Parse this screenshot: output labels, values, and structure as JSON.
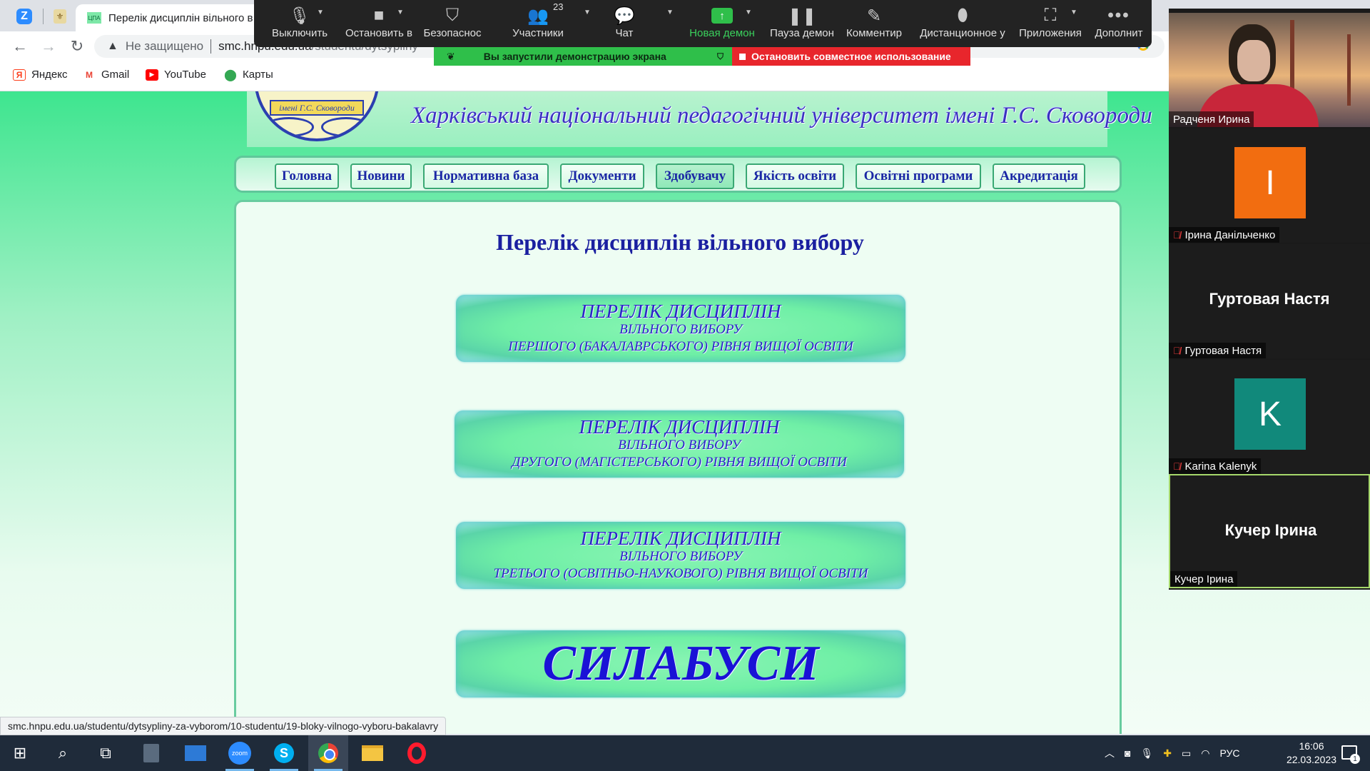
{
  "browser": {
    "active_tab_title": "Перелік дисциплін вільного в",
    "active_tab_favicon": "ЦПА",
    "not_secure_label": "Не защищено",
    "url_domain": "smc.hnpu.edu.ua",
    "url_path": "/studentu/dytsypliny",
    "status_url": "smc.hnpu.edu.ua/studentu/dytsypliny-za-vyborom/10-studentu/19-bloky-vilnogo-vyboru-bakalavry",
    "bookmarks": [
      {
        "label": "Яндекс",
        "icon": "yandex-icon",
        "color": "#fc3f1d"
      },
      {
        "label": "Gmail",
        "icon": "gmail-icon",
        "color": "#ea4335"
      },
      {
        "label": "YouTube",
        "icon": "youtube-icon",
        "color": "#ff0000"
      },
      {
        "label": "Карты",
        "icon": "maps-pin-icon",
        "color": "#34a853"
      }
    ]
  },
  "zoom": {
    "controls": {
      "mute": "Выключить",
      "stop_video": "Остановить в",
      "security": "Безопаснос",
      "participants": "Участники",
      "participants_count": "23",
      "chat": "Чат",
      "new_share": "Новая демон",
      "pause_share": "Пауза демон",
      "annotate": "Комментир",
      "remote_control": "Дистанционное у",
      "apps": "Приложения",
      "more": "Дополнит"
    },
    "share_notice": "Вы запустили демонстрацию экрана",
    "stop_share": "Остановить совместное использование",
    "participants": [
      {
        "name": "Радченя Ирина",
        "type": "video",
        "muted": false
      },
      {
        "name": "Ірина Данільченко",
        "type": "avatar",
        "initial": "I",
        "avatar_color": "#f26d10",
        "muted": true
      },
      {
        "name": "Гуртовая Настя",
        "type": "name",
        "muted": true
      },
      {
        "name": "Karina Kalenyk",
        "type": "avatar",
        "initial": "K",
        "avatar_color": "#11897b",
        "muted": true
      },
      {
        "name": "Кучер Ірина",
        "type": "name",
        "muted": false,
        "active_speaker": true
      }
    ]
  },
  "site": {
    "logo_text": "імені Г.С. Сковороди",
    "university_title": "Харківський національний педагогічний університет імені Г.С. Сковороди",
    "nav": [
      {
        "label": "Головна",
        "active": false
      },
      {
        "label": "Новини",
        "active": false
      },
      {
        "label": "Нормативна база",
        "active": false
      },
      {
        "label": "Документи",
        "active": false
      },
      {
        "label": "Здобувачу",
        "active": true
      },
      {
        "label": "Якість освіти",
        "active": false
      },
      {
        "label": "Освітні програми",
        "active": false
      },
      {
        "label": "Акредитація",
        "active": false
      }
    ],
    "page_heading": "Перелік дисциплін вільного вибору",
    "link_boxes": [
      {
        "line1": "ПЕРЕЛІК ДИСЦИПЛІН",
        "line2": "ВІЛЬНОГО ВИБОРУ",
        "line3": "ПЕРШОГО (БАКАЛАВРСЬКОГО) РІВНЯ ВИЩОЇ ОСВІТИ"
      },
      {
        "line1": "ПЕРЕЛІК ДИСЦИПЛІН",
        "line2": "ВІЛЬНОГО ВИБОРУ",
        "line3": "ДРУГОГО (МАГІСТЕРСЬКОГО) РІВНЯ ВИЩОЇ ОСВІТИ"
      },
      {
        "line1": "ПЕРЕЛІК ДИСЦИПЛІН",
        "line2": "ВІЛЬНОГО ВИБОРУ",
        "line3": "ТРЕТЬОГО (ОСВІТНЬО-НАУКОВОГО) РІВНЯ ВИЩОЇ ОСВІТИ"
      }
    ],
    "syllabus_label": "СИЛАБУСИ"
  },
  "taskbar": {
    "language": "РУС",
    "time": "16:06",
    "date": "22.03.2023",
    "notifications": "1",
    "zoom_label": "zoom",
    "skype_label": "S"
  }
}
